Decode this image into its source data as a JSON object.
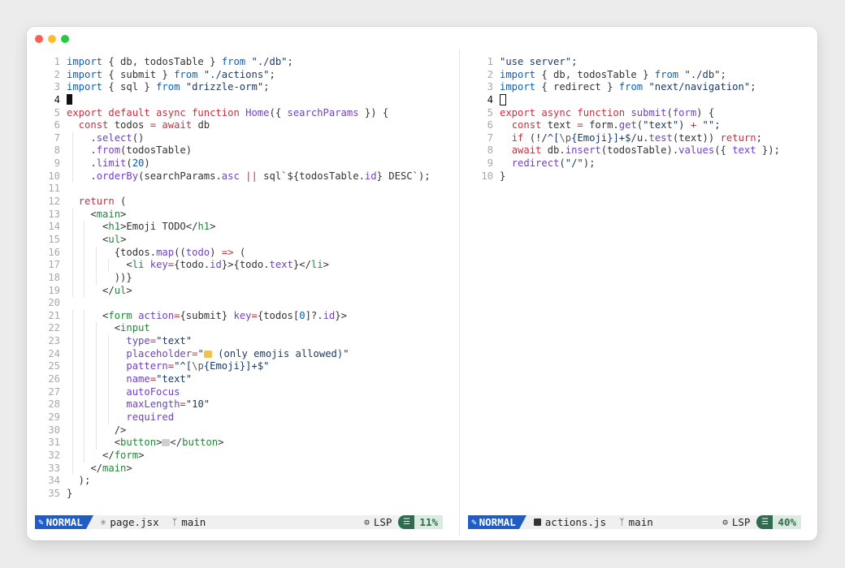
{
  "left_pane": {
    "lines": [
      {
        "n": "1",
        "parts": [
          [
            "imp",
            "import"
          ],
          [
            "var",
            " { db, todosTable } "
          ],
          [
            "imp",
            "from"
          ],
          [
            "str",
            " \"./db\""
          ],
          [
            "var",
            ";"
          ]
        ]
      },
      {
        "n": "2",
        "parts": [
          [
            "imp",
            "import"
          ],
          [
            "var",
            " { submit } "
          ],
          [
            "imp",
            "from"
          ],
          [
            "str",
            " \"./actions\""
          ],
          [
            "var",
            ";"
          ]
        ]
      },
      {
        "n": "3",
        "parts": [
          [
            "imp",
            "import"
          ],
          [
            "var",
            " { sql } "
          ],
          [
            "imp",
            "from"
          ],
          [
            "str",
            " \"drizzle-orm\""
          ],
          [
            "var",
            ";"
          ]
        ]
      },
      {
        "n": "4",
        "cursor": "block",
        "parts": []
      },
      {
        "n": "5",
        "parts": [
          [
            "kw",
            "export default async function "
          ],
          [
            "fn",
            "Home"
          ],
          [
            "var",
            "({ "
          ],
          [
            "attr",
            "searchParams"
          ],
          [
            "var",
            " }) {"
          ]
        ]
      },
      {
        "n": "6",
        "parts": [
          [
            "var",
            "  "
          ],
          [
            "kw",
            "const"
          ],
          [
            "var",
            " todos "
          ],
          [
            "op",
            "="
          ],
          [
            "kw",
            " await"
          ],
          [
            "var",
            " db"
          ]
        ]
      },
      {
        "n": "7",
        "parts": [
          [
            "var",
            "    ."
          ],
          [
            "fn",
            "select"
          ],
          [
            "var",
            "()"
          ]
        ]
      },
      {
        "n": "8",
        "parts": [
          [
            "var",
            "    ."
          ],
          [
            "fn",
            "from"
          ],
          [
            "var",
            "(todosTable)"
          ]
        ]
      },
      {
        "n": "9",
        "parts": [
          [
            "var",
            "    ."
          ],
          [
            "fn",
            "limit"
          ],
          [
            "var",
            "("
          ],
          [
            "num",
            "20"
          ],
          [
            "var",
            ")"
          ]
        ]
      },
      {
        "n": "10",
        "parts": [
          [
            "var",
            "    ."
          ],
          [
            "fn",
            "orderBy"
          ],
          [
            "var",
            "(searchParams."
          ],
          [
            "attr",
            "asc"
          ],
          [
            "op",
            " ||"
          ],
          [
            "var",
            " sql`${todosTable."
          ],
          [
            "attr",
            "id"
          ],
          [
            "var",
            "} DESC`);"
          ]
        ]
      },
      {
        "n": "11",
        "parts": []
      },
      {
        "n": "12",
        "parts": [
          [
            "var",
            "  "
          ],
          [
            "kw",
            "return"
          ],
          [
            "var",
            " ("
          ]
        ]
      },
      {
        "n": "13",
        "parts": [
          [
            "var",
            "    <"
          ],
          [
            "tag",
            "main"
          ],
          [
            "var",
            ">"
          ]
        ]
      },
      {
        "n": "14",
        "parts": [
          [
            "var",
            "      <"
          ],
          [
            "tag",
            "h1"
          ],
          [
            "var",
            ">Emoji TODO</"
          ],
          [
            "tag",
            "h1"
          ],
          [
            "var",
            ">"
          ]
        ]
      },
      {
        "n": "15",
        "parts": [
          [
            "var",
            "      <"
          ],
          [
            "tag",
            "ul"
          ],
          [
            "var",
            ">"
          ]
        ]
      },
      {
        "n": "16",
        "parts": [
          [
            "var",
            "        {todos."
          ],
          [
            "fn",
            "map"
          ],
          [
            "var",
            "(("
          ],
          [
            "attr",
            "todo"
          ],
          [
            "var",
            ") "
          ],
          [
            "op",
            "=>"
          ],
          [
            "var",
            " ("
          ]
        ]
      },
      {
        "n": "17",
        "parts": [
          [
            "var",
            "          <"
          ],
          [
            "tag",
            "li"
          ],
          [
            "attr",
            " key"
          ],
          [
            "op",
            "="
          ],
          [
            "var",
            "{todo."
          ],
          [
            "attr",
            "id"
          ],
          [
            "var",
            "}>{todo."
          ],
          [
            "attr",
            "text"
          ],
          [
            "var",
            "}</"
          ],
          [
            "tag",
            "li"
          ],
          [
            "var",
            ">"
          ]
        ]
      },
      {
        "n": "18",
        "parts": [
          [
            "var",
            "        ))}"
          ]
        ]
      },
      {
        "n": "19",
        "parts": [
          [
            "var",
            "      </"
          ],
          [
            "tag",
            "ul"
          ],
          [
            "var",
            ">"
          ]
        ]
      },
      {
        "n": "20",
        "parts": []
      },
      {
        "n": "21",
        "parts": [
          [
            "var",
            "      <"
          ],
          [
            "tag",
            "form"
          ],
          [
            "attr",
            " action"
          ],
          [
            "op",
            "="
          ],
          [
            "var",
            "{submit}"
          ],
          [
            "attr",
            " key"
          ],
          [
            "op",
            "="
          ],
          [
            "var",
            "{todos["
          ],
          [
            "num",
            "0"
          ],
          [
            "var",
            "]?."
          ],
          [
            "attr",
            "id"
          ],
          [
            "var",
            "}>"
          ]
        ]
      },
      {
        "n": "22",
        "parts": [
          [
            "var",
            "        <"
          ],
          [
            "tag",
            "input"
          ]
        ]
      },
      {
        "n": "23",
        "parts": [
          [
            "attr",
            "          type"
          ],
          [
            "op",
            "="
          ],
          [
            "str",
            "\"text\""
          ]
        ]
      },
      {
        "n": "24",
        "parts": [
          [
            "attr",
            "          placeholder"
          ],
          [
            "op",
            "="
          ],
          [
            "str",
            "\""
          ],
          [
            "emoji",
            "note"
          ],
          [
            "str",
            " (only emojis allowed)\""
          ]
        ]
      },
      {
        "n": "25",
        "parts": [
          [
            "attr",
            "          pattern"
          ],
          [
            "op",
            "="
          ],
          [
            "str",
            "\"^["
          ],
          [
            "esc",
            "\\p"
          ],
          [
            "str",
            "{Emoji}]+$\""
          ]
        ]
      },
      {
        "n": "26",
        "parts": [
          [
            "attr",
            "          name"
          ],
          [
            "op",
            "="
          ],
          [
            "str",
            "\"text\""
          ]
        ]
      },
      {
        "n": "27",
        "parts": [
          [
            "attr",
            "          autoFocus"
          ]
        ]
      },
      {
        "n": "28",
        "parts": [
          [
            "attr",
            "          maxLength"
          ],
          [
            "op",
            "="
          ],
          [
            "str",
            "\"10\""
          ]
        ]
      },
      {
        "n": "29",
        "parts": [
          [
            "attr",
            "          required"
          ]
        ]
      },
      {
        "n": "30",
        "parts": [
          [
            "var",
            "        />"
          ]
        ]
      },
      {
        "n": "31",
        "parts": [
          [
            "var",
            "        <"
          ],
          [
            "tag",
            "button"
          ],
          [
            "var",
            ">"
          ],
          [
            "emoji",
            "gray"
          ],
          [
            "var",
            "</"
          ],
          [
            "tag",
            "button"
          ],
          [
            "var",
            ">"
          ]
        ]
      },
      {
        "n": "32",
        "parts": [
          [
            "var",
            "      </"
          ],
          [
            "tag",
            "form"
          ],
          [
            "var",
            ">"
          ]
        ]
      },
      {
        "n": "33",
        "parts": [
          [
            "var",
            "    </"
          ],
          [
            "tag",
            "main"
          ],
          [
            "var",
            ">"
          ]
        ]
      },
      {
        "n": "34",
        "parts": [
          [
            "var",
            "  );"
          ]
        ]
      },
      {
        "n": "35",
        "parts": [
          [
            "var",
            "}"
          ]
        ]
      }
    ],
    "status": {
      "mode": "NORMAL",
      "file": "page.jsx",
      "branch": "main",
      "lsp": "LSP",
      "percent": "11%"
    }
  },
  "right_pane": {
    "lines": [
      {
        "n": "1",
        "parts": [
          [
            "str",
            "\"use server\""
          ],
          [
            "var",
            ";"
          ]
        ]
      },
      {
        "n": "2",
        "parts": [
          [
            "imp",
            "import"
          ],
          [
            "var",
            " { db, todosTable } "
          ],
          [
            "imp",
            "from"
          ],
          [
            "str",
            " \"./db\""
          ],
          [
            "var",
            ";"
          ]
        ]
      },
      {
        "n": "3",
        "parts": [
          [
            "imp",
            "import"
          ],
          [
            "var",
            " { redirect } "
          ],
          [
            "imp",
            "from"
          ],
          [
            "str",
            " \"next/navigation\""
          ],
          [
            "var",
            ";"
          ]
        ]
      },
      {
        "n": "4",
        "cursor": "hollow",
        "parts": []
      },
      {
        "n": "5",
        "parts": [
          [
            "kw",
            "export async function "
          ],
          [
            "fn",
            "submit"
          ],
          [
            "var",
            "("
          ],
          [
            "attr",
            "form"
          ],
          [
            "var",
            ") {"
          ]
        ]
      },
      {
        "n": "6",
        "parts": [
          [
            "var",
            "  "
          ],
          [
            "kw",
            "const"
          ],
          [
            "var",
            " text "
          ],
          [
            "op",
            "="
          ],
          [
            "var",
            " form."
          ],
          [
            "fn",
            "get"
          ],
          [
            "var",
            "("
          ],
          [
            "str",
            "\"text\""
          ],
          [
            "var",
            ") "
          ],
          [
            "op",
            "+"
          ],
          [
            "str",
            " \"\""
          ],
          [
            "var",
            ";"
          ]
        ]
      },
      {
        "n": "7",
        "parts": [
          [
            "var",
            "  "
          ],
          [
            "kw",
            "if"
          ],
          [
            "var",
            " (!/"
          ],
          [
            "str",
            "^["
          ],
          [
            "esc",
            "\\p"
          ],
          [
            "str",
            "{Emoji}]+$"
          ],
          [
            "var",
            "/u."
          ],
          [
            "fn",
            "test"
          ],
          [
            "var",
            "(text)) "
          ],
          [
            "kw",
            "return"
          ],
          [
            "var",
            ";"
          ]
        ]
      },
      {
        "n": "8",
        "parts": [
          [
            "var",
            "  "
          ],
          [
            "kw",
            "await"
          ],
          [
            "var",
            " db."
          ],
          [
            "fn",
            "insert"
          ],
          [
            "var",
            "(todosTable)."
          ],
          [
            "fn",
            "values"
          ],
          [
            "var",
            "({ "
          ],
          [
            "attr",
            "text"
          ],
          [
            "var",
            " });"
          ]
        ]
      },
      {
        "n": "9",
        "parts": [
          [
            "var",
            "  "
          ],
          [
            "fn",
            "redirect"
          ],
          [
            "var",
            "("
          ],
          [
            "str",
            "\"/\""
          ],
          [
            "var",
            ");"
          ]
        ]
      },
      {
        "n": "10",
        "parts": [
          [
            "var",
            "}"
          ]
        ]
      }
    ],
    "status": {
      "mode": "NORMAL",
      "file": "actions.js",
      "branch": "main",
      "lsp": "LSP",
      "percent": "40%"
    }
  }
}
